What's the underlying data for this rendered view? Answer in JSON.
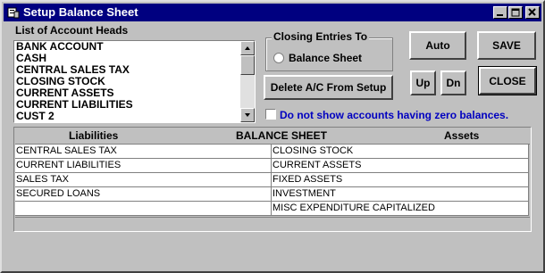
{
  "window": {
    "title": "Setup Balance Sheet",
    "title_icon": "app-icon",
    "controls": [
      "minimize-icon",
      "maximize-icon",
      "close-icon"
    ]
  },
  "account_heads": {
    "label": "List of Account Heads",
    "items": [
      "BANK ACCOUNT",
      "CASH",
      "CENTRAL SALES TAX",
      "CLOSING STOCK",
      "CURRENT ASSETS",
      "CURRENT LIABILITIES",
      "CUST 2"
    ]
  },
  "closing_entries": {
    "caption": "Closing Entries To",
    "option_label": "Balance Sheet",
    "selected": false
  },
  "buttons": {
    "auto": "Auto",
    "save": "SAVE",
    "up": "Up",
    "dn": "Dn",
    "close": "CLOSE",
    "delete": "Delete A/C From Setup"
  },
  "zero_balance": {
    "label": "Do not show accounts having zero balances.",
    "checked": false
  },
  "balance_sheet": {
    "headers": {
      "liabilities": "Liabilities",
      "title": "BALANCE SHEET",
      "assets": "Assets"
    },
    "rows": [
      {
        "liability": "CENTRAL SALES TAX",
        "asset": "CLOSING STOCK"
      },
      {
        "liability": "CURRENT LIABILITIES",
        "asset": "CURRENT ASSETS"
      },
      {
        "liability": "SALES TAX",
        "asset": "FIXED ASSETS"
      },
      {
        "liability": "SECURED LOANS",
        "asset": "INVESTMENT"
      },
      {
        "liability": "",
        "asset": "MISC EXPENDITURE CAPITALIZED"
      }
    ]
  },
  "colors": {
    "titlebar": "#000080",
    "face": "#c0c0c0",
    "checkbox_label": "#0000c0"
  }
}
